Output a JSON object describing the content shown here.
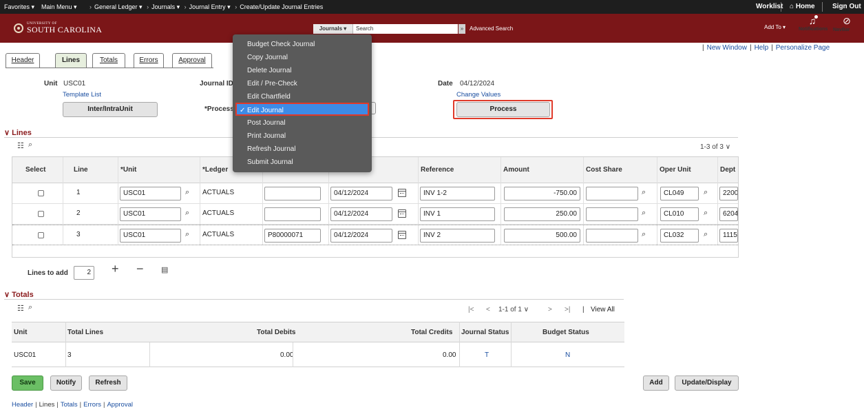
{
  "nav": {
    "favorites": "Favorites",
    "main_menu": "Main Menu",
    "breadcrumbs": [
      "General Ledger",
      "Journals",
      "Journal Entry",
      "Create/Update Journal Entries"
    ],
    "worklist": "Worklist",
    "home": "Home",
    "sign_out": "Sign Out"
  },
  "brand": {
    "small": "UNIVERSITY OF",
    "big": "SOUTH CAROLINA"
  },
  "search": {
    "category": "Journals",
    "placeholder": "Search",
    "advanced": "Advanced Search"
  },
  "header_icons": {
    "add_to": "Add To",
    "notifications": "Notifications",
    "navbar": "NavBar"
  },
  "util_links": {
    "new_window": "New Window",
    "help": "Help",
    "personalize": "Personalize Page"
  },
  "tabs": [
    "Header",
    "Lines",
    "Totals",
    "Errors",
    "Approval"
  ],
  "form": {
    "unit_label": "Unit",
    "unit_value": "USC01",
    "template_list": "Template List",
    "interunit_button": "Inter/IntraUnit",
    "journal_id_label": "Journal ID",
    "date_label": "Date",
    "date_value": "04/12/2024",
    "change_values": "Change Values",
    "process_label": "*Process",
    "process_button": "Process"
  },
  "dropdown": {
    "items": [
      "Budget Check Journal",
      "Copy Journal",
      "Delete Journal",
      "Edit / Pre-Check",
      "Edit Chartfield",
      "Edit Journal",
      "Post Journal",
      "Print Journal",
      "Refresh Journal",
      "Submit Journal"
    ],
    "selected": "Edit Journal"
  },
  "lines_section": {
    "title": "Lines",
    "pager": "1-3 of 3",
    "columns": [
      "Select",
      "Line",
      "*Unit",
      "*Ledger",
      "Reference",
      "Amount",
      "Cost Share",
      "Oper Unit",
      "Dept"
    ],
    "rows": [
      {
        "line": "1",
        "unit": "USC01",
        "ledger": "ACTUALS",
        "col4": "",
        "date": "04/12/2024",
        "reference": "INV 1-2",
        "amount": "-750.00",
        "cost_share": "",
        "oper_unit": "CL049",
        "dept": "2200"
      },
      {
        "line": "2",
        "unit": "USC01",
        "ledger": "ACTUALS",
        "col4": "",
        "date": "04/12/2024",
        "reference": "INV 1",
        "amount": "250.00",
        "cost_share": "",
        "oper_unit": "CL010",
        "dept": "6204"
      },
      {
        "line": "3",
        "unit": "USC01",
        "ledger": "ACTUALS",
        "col4": "P80000071",
        "date": "04/12/2024",
        "reference": "INV 2",
        "amount": "500.00",
        "cost_share": "",
        "oper_unit": "CL032",
        "dept": "1115"
      }
    ],
    "lines_to_add_label": "Lines to add",
    "lines_to_add_value": "2"
  },
  "totals_section": {
    "title": "Totals",
    "pager": "1-1 of 1",
    "view_all": "View All",
    "columns": [
      "Unit",
      "Total Lines",
      "Total Debits",
      "Total Credits",
      "Journal Status",
      "Budget Status"
    ],
    "row": {
      "unit": "USC01",
      "total_lines": "3",
      "total_debits": "0.00",
      "total_credits": "0.00",
      "journal_status": "T",
      "budget_status": "N"
    }
  },
  "buttons": {
    "save": "Save",
    "notify": "Notify",
    "refresh": "Refresh",
    "add": "Add",
    "update_display": "Update/Display"
  },
  "footer_links": [
    "Header",
    "Lines",
    "Totals",
    "Errors",
    "Approval"
  ]
}
